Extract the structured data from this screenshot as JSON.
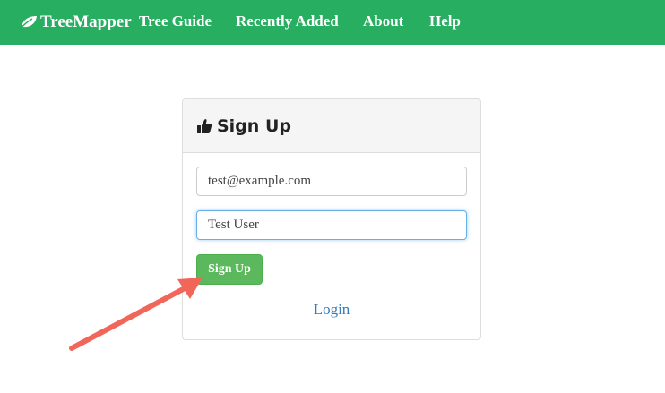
{
  "navbar": {
    "brand": "TreeMapper",
    "brand_icon": "leaf-icon",
    "links": [
      "Tree Guide",
      "Recently Added",
      "About",
      "Help"
    ],
    "background": "#27ae60"
  },
  "signup_panel": {
    "title": "Sign Up",
    "title_icon": "thumbs-up-icon",
    "email_value": "test@example.com",
    "name_value": "Test User",
    "submit_label": "Sign Up",
    "login_label": "Login",
    "submit_color": "#5cb85c",
    "link_color": "#337ab7"
  },
  "annotation": {
    "arrow_color": "#f2665a",
    "arrow_icon": "arrow-pointer-icon"
  }
}
